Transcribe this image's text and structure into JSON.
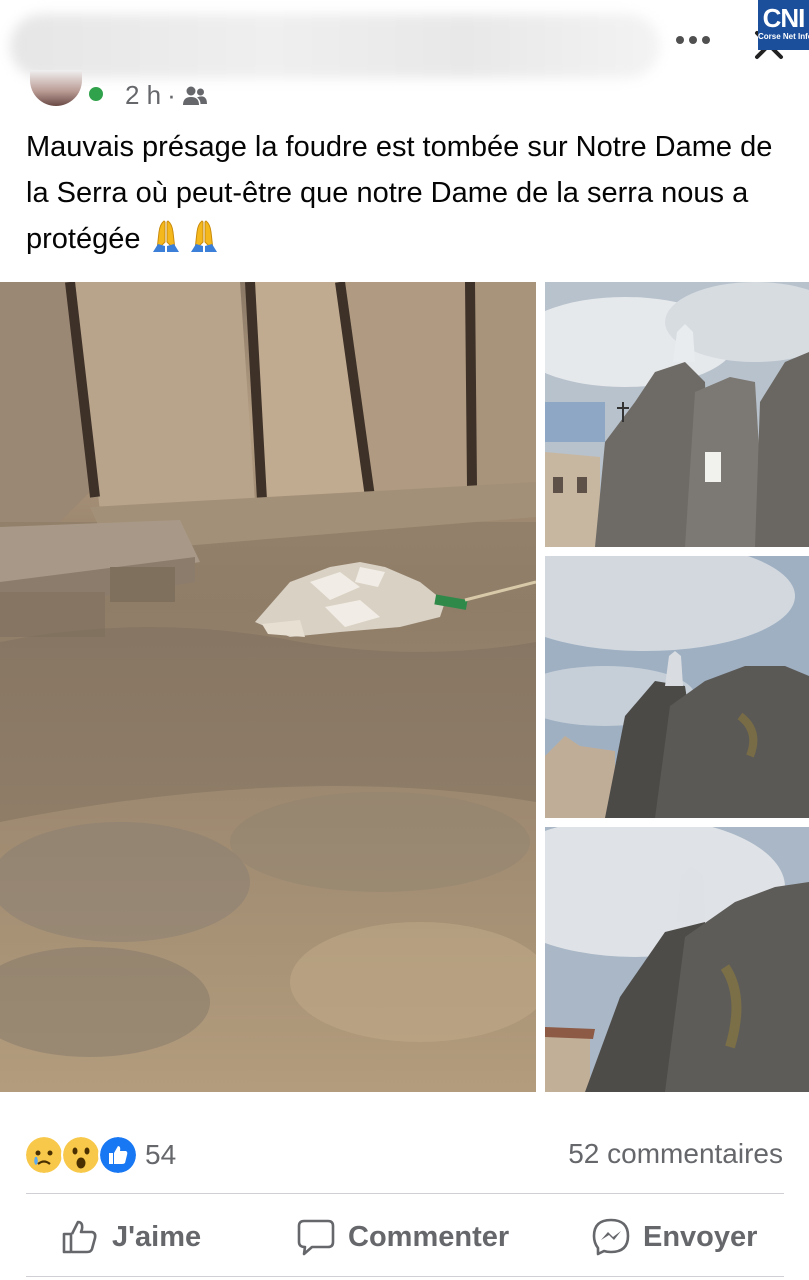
{
  "header": {
    "time": "2 h",
    "separator": "·",
    "audience_icon": "friends-icon",
    "more_icon": "more-dots-icon",
    "close_icon": "close-icon",
    "logo": {
      "main": "CNI",
      "sub": "Corse Net Infos"
    }
  },
  "post": {
    "text": "Mauvais présage la foudre est tombée sur Notre Dame de la Serra où peut-être que notre Dame de la serra nous a protégée",
    "emoji": [
      "folded-hands-icon",
      "folded-hands-icon"
    ]
  },
  "photos": [
    "rock-ground-debris-photo",
    "statue-rocks-sky-photo-1",
    "statue-rocks-sky-photo-2",
    "statue-rocks-sky-photo-3"
  ],
  "engagement": {
    "reaction_icons": [
      "sad-reaction-icon",
      "wow-reaction-icon",
      "like-reaction-icon"
    ],
    "reaction_count": "54",
    "comments": "52 commentaires"
  },
  "actions": {
    "like": "J'aime",
    "comment": "Commenter",
    "send": "Envoyer"
  },
  "colors": {
    "secondary_text": "#65676b",
    "like_blue": "#1877f2",
    "online_green": "#31a24c"
  }
}
